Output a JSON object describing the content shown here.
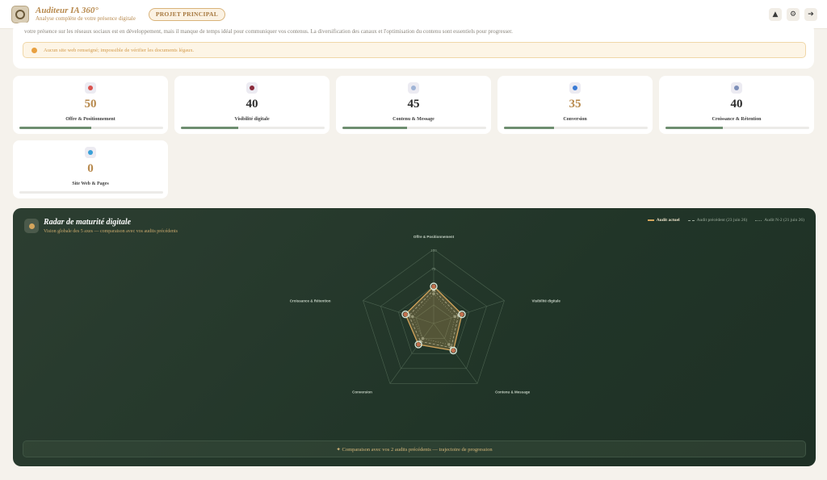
{
  "header": {
    "app_title": "Auditeur IA 360°",
    "app_subtitle": "Analyse complète de votre présence digitale",
    "project_badge": "PROJET PRINCIPAL",
    "icons": [
      "notification-icon",
      "settings-icon",
      "logout-icon"
    ]
  },
  "summary": {
    "text": "votre présence sur les réseaux sociaux est en développement, mais il manque de temps idéal pour communiquer vos contenus. La diversification des canaux et l'optimisation du contenu sont essentiels pour progresser.",
    "alert": "Aucun site web renseigné; impossible de vérifier les documents légaux."
  },
  "scores": [
    {
      "label": "Offre & Positionnement",
      "value": "50",
      "progress": 0.5,
      "color": "#b88a4e",
      "icon": "target-icon",
      "icon_color": "#d9534f"
    },
    {
      "label": "Visibilité digitale",
      "value": "40",
      "progress": 0.4,
      "color": "#2b2b2b",
      "icon": "eye-icon",
      "icon_color": "#8a2a3a"
    },
    {
      "label": "Contenu & Message",
      "value": "45",
      "progress": 0.45,
      "color": "#2b2b2b",
      "icon": "chat-icon",
      "icon_color": "#9fb4d6"
    },
    {
      "label": "Conversion",
      "value": "35",
      "progress": 0.35,
      "color": "#b88a4e",
      "icon": "cart-icon",
      "icon_color": "#3a7bd5"
    },
    {
      "label": "Croissance & Rétention",
      "value": "40",
      "progress": 0.4,
      "color": "#2b2b2b",
      "icon": "growth-chart-icon",
      "icon_color": "#7d8fb8"
    },
    {
      "label": "Site Web & Pages",
      "value": "0",
      "progress": 0.0,
      "color": "#b88a4e",
      "icon": "globe-icon",
      "icon_color": "#3aa0d8"
    }
  ],
  "radar": {
    "title": "Radar de maturité digitale",
    "subtitle": "Vision globale des 5 axes — comparaison avec vos audits précédents",
    "legend": {
      "current": "Audit actuel",
      "previous": "Audit précédent (23 juin 26)",
      "n2": "Audit N-2 (21 juin 26)"
    },
    "compare_button": "✦ Comparaison avec vos 2 audits précédents — trajectoire de progression"
  },
  "chart_data": {
    "type": "radar",
    "axes": [
      "Offre & Positionnement",
      "Visibilité digitale",
      "Contenu & Message",
      "Conversion",
      "Croissance & Rétention"
    ],
    "rmax": 100,
    "rings": [
      25,
      50,
      75,
      100
    ],
    "ring_labels": [
      "75",
      "100"
    ],
    "series": [
      {
        "name": "Audit actuel",
        "values": [
          50,
          40,
          45,
          35,
          40
        ],
        "color": "#d4a55c"
      },
      {
        "name": "Audit précédent (23 juin 26)",
        "values": [
          45,
          35,
          40,
          30,
          35
        ],
        "color": "#9eae9f"
      },
      {
        "name": "Audit N-2 (21 juin 26)",
        "values": [
          40,
          30,
          35,
          25,
          30
        ],
        "color": "#7d8f7e"
      }
    ]
  }
}
